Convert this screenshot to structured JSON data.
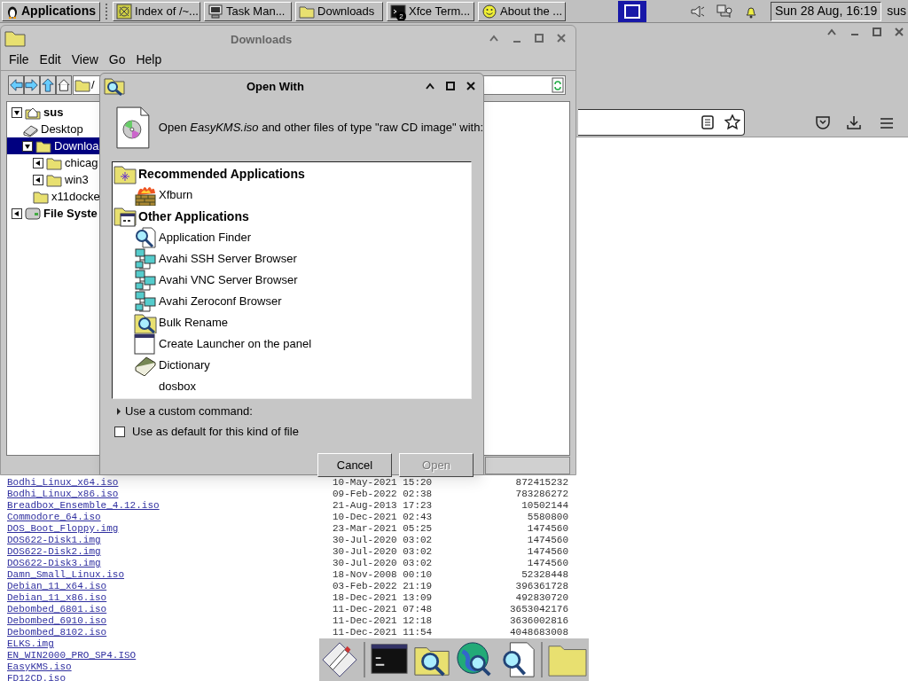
{
  "panel": {
    "apps_button": "Applications",
    "tasks": [
      {
        "label": "Index of /~...",
        "kind": "web"
      },
      {
        "label": "Task Man...",
        "kind": "monitor"
      },
      {
        "label": "Downloads",
        "kind": "folder"
      },
      {
        "label": "Xfce Term...",
        "kind": "terminal",
        "badge": "2"
      },
      {
        "label": "About the ...",
        "kind": "smiley"
      }
    ],
    "clock": "Sun 28 Aug, 16:19",
    "user": "sus"
  },
  "file_manager": {
    "title": "Downloads",
    "menu": [
      "File",
      "Edit",
      "View",
      "Go",
      "Help"
    ],
    "location": "/",
    "tree": [
      {
        "label": "sus",
        "kind": "home",
        "expanded": true,
        "selected": false,
        "children": [
          {
            "label": "Desktop",
            "kind": "desktop",
            "selected": false
          },
          {
            "label": "Downloa",
            "kind": "folder",
            "expanded": true,
            "selected": true,
            "children": [
              {
                "label": "chicag",
                "kind": "folder",
                "expanded": false,
                "selected": false
              },
              {
                "label": "win3",
                "kind": "folder",
                "expanded": false,
                "selected": false
              },
              {
                "label": "x11docke",
                "kind": "folder",
                "selected": false
              }
            ]
          }
        ]
      },
      {
        "label": "File Syste",
        "kind": "drive",
        "expanded": false,
        "selected": false
      }
    ]
  },
  "dialog": {
    "title": "Open With",
    "prompt": "Open *EasyKMS.iso* and other files of type \"raw CD image\" with:",
    "groups": [
      {
        "label": "Recommended Applications",
        "kind": "star",
        "apps": [
          {
            "name": "Xfburn",
            "kind": "burner"
          }
        ]
      },
      {
        "label": "Other Applications",
        "kind": "apps",
        "apps": [
          {
            "name": "Application Finder",
            "kind": "finder"
          },
          {
            "name": "Avahi SSH Server Browser",
            "kind": "network"
          },
          {
            "name": "Avahi VNC Server Browser",
            "kind": "network"
          },
          {
            "name": "Avahi Zeroconf Browser",
            "kind": "network"
          },
          {
            "name": "Bulk Rename",
            "kind": "rename"
          },
          {
            "name": "Create Launcher on the panel",
            "kind": "launcher"
          },
          {
            "name": "Dictionary",
            "kind": "book"
          },
          {
            "name": "dosbox",
            "kind": "blank"
          }
        ]
      }
    ],
    "custom_command": {
      "label": "Use a custom command:",
      "expanded": false
    },
    "default_checkbox": {
      "label": "Use as default for this kind of file",
      "checked": false
    },
    "buttons": [
      {
        "label": "Cancel",
        "disabled": false
      },
      {
        "label": "Open",
        "disabled": true
      }
    ]
  },
  "listing": {
    "rows": [
      {
        "name": "Bodhi_Linux_x64.iso",
        "date": "10-May-2021 15:20",
        "size": "872415232"
      },
      {
        "name": "Bodhi_Linux_x86.iso",
        "date": "09-Feb-2022 02:38",
        "size": "783286272"
      },
      {
        "name": "Breadbox_Ensemble_4.12.iso",
        "date": "21-Aug-2013 17:23",
        "size": "10502144"
      },
      {
        "name": "Commodore_64.iso",
        "date": "10-Dec-2021 02:43",
        "size": "5580800"
      },
      {
        "name": "DOS_Boot_Floppy.img",
        "date": "23-Mar-2021 05:25",
        "size": "1474560"
      },
      {
        "name": "DOS622-Disk1.img",
        "date": "30-Jul-2020 03:02",
        "size": "1474560"
      },
      {
        "name": "DOS622-Disk2.img",
        "date": "30-Jul-2020 03:02",
        "size": "1474560"
      },
      {
        "name": "DOS622-Disk3.img",
        "date": "30-Jul-2020 03:02",
        "size": "1474560"
      },
      {
        "name": "Damn_Small_Linux.iso",
        "date": "18-Nov-2008 00:10",
        "size": "52328448"
      },
      {
        "name": "Debian_11_x64.iso",
        "date": "03-Feb-2022 21:19",
        "size": "396361728"
      },
      {
        "name": "Debian_11_x86.iso",
        "date": "18-Dec-2021 13:09",
        "size": "492830720"
      },
      {
        "name": "Debombed_6801.iso",
        "date": "11-Dec-2021 07:48",
        "size": "3653042176"
      },
      {
        "name": "Debombed_6910.iso",
        "date": "11-Dec-2021 12:18",
        "size": "3636002816"
      },
      {
        "name": "Debombed_8102.iso",
        "date": "11-Dec-2021 11:54",
        "size": "4048683008"
      },
      {
        "name": "ELKS.img"
      },
      {
        "name": "EN_WIN2000_PRO_SP4.ISO"
      },
      {
        "name": "EasyKMS.iso"
      },
      {
        "name": "FD12CD.iso"
      }
    ]
  }
}
